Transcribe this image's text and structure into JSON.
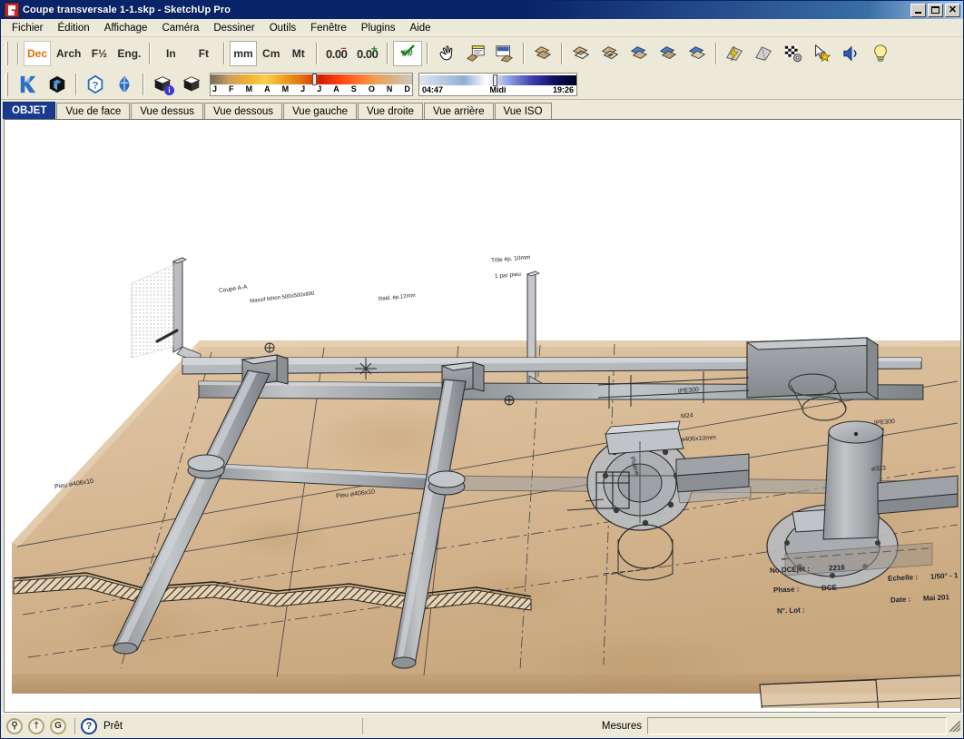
{
  "window": {
    "title": "Coupe transversale 1-1.skp - SketchUp Pro",
    "app_icon": "sketchup-icon",
    "minimize_label": "_",
    "maximize_label": "□",
    "close_label": "✕"
  },
  "menubar": {
    "items": [
      {
        "label": "Fichier",
        "accel": "F"
      },
      {
        "label": "Édition",
        "accel": "É"
      },
      {
        "label": "Affichage",
        "accel": "h"
      },
      {
        "label": "Caméra",
        "accel": "a"
      },
      {
        "label": "Dessiner",
        "accel": "D"
      },
      {
        "label": "Outils",
        "accel": "O"
      },
      {
        "label": "Fenêtre",
        "accel": "F"
      },
      {
        "label": "Plugins",
        "accel": ""
      },
      {
        "label": "Aide",
        "accel": "A"
      }
    ]
  },
  "toolbar_units": {
    "formats": [
      {
        "label": "Dec",
        "name": "unit-decimal",
        "active": true
      },
      {
        "label": "Arch",
        "name": "unit-architectural",
        "active": false
      },
      {
        "label": "F½",
        "name": "unit-fractional",
        "active": false
      },
      {
        "label": "Eng.",
        "name": "unit-engineering",
        "active": false
      }
    ],
    "imperial": [
      {
        "label": "In",
        "name": "unit-inches",
        "active": false
      },
      {
        "label": "Ft",
        "name": "unit-feet",
        "active": false
      }
    ],
    "metric": [
      {
        "label": "mm",
        "name": "unit-millimeters",
        "active": true
      },
      {
        "label": "Cm",
        "name": "unit-centimeters",
        "active": false
      },
      {
        "label": "Mt",
        "name": "unit-meters",
        "active": false
      }
    ],
    "precision": [
      {
        "label": "0.00",
        "name": "precision-decrease-button",
        "badge": "−",
        "badge_color": "#d02b20"
      },
      {
        "label": "0.00",
        "name": "precision-increase-button",
        "badge": "+",
        "badge_color": "#2c8c2c"
      }
    ],
    "snap": {
      "label": "##",
      "name": "snap-toggle-button"
    }
  },
  "toolbar_tools": {
    "items": [
      {
        "name": "pan-hand-icon",
        "title": "Panoramique"
      },
      {
        "name": "entity-info-icon",
        "title": "Infos sur l'entité"
      },
      {
        "name": "materials-icon",
        "title": "Matériaux"
      }
    ]
  },
  "toolbar_layers": {
    "items": [
      {
        "name": "group-icon",
        "title": "Groupe"
      },
      {
        "name": "layer-wireframe-icon",
        "title": "Filaire"
      },
      {
        "name": "layer-hidden-line-icon",
        "title": "Ligne cachée"
      },
      {
        "name": "layer-shaded-icon",
        "title": "Ombré"
      },
      {
        "name": "layer-texture-icon",
        "title": "Ombré avec textures"
      },
      {
        "name": "layer-monochrome-icon",
        "title": "Monochrome"
      }
    ]
  },
  "toolbar_render": {
    "items": [
      {
        "name": "render-lightning-icon",
        "title": "Rendu rapide"
      },
      {
        "name": "render-icon",
        "title": "Rendu"
      },
      {
        "name": "render-settings-icon",
        "title": "Options de rendu"
      },
      {
        "name": "select-star-icon",
        "title": "Sélection"
      },
      {
        "name": "sound-icon",
        "title": "Son"
      },
      {
        "name": "lightbulb-icon",
        "title": "Éclairage"
      }
    ]
  },
  "toolbar_row2": {
    "left_items": [
      {
        "name": "kerkythea-k-icon",
        "title": "Kerkythea"
      },
      {
        "name": "cube-3d-icon",
        "title": "Modèle 3D"
      },
      {
        "name": "help-hex-icon",
        "title": "Aide"
      },
      {
        "name": "plugin-ornament-icon",
        "title": "Extension"
      }
    ],
    "shadow_items": [
      {
        "name": "shadow-info-icon",
        "title": "Ombres - infos"
      },
      {
        "name": "shadow-icon",
        "title": "Ombres"
      }
    ]
  },
  "shadow_sliders": {
    "month": {
      "name": "month-slider",
      "labels": [
        "J",
        "F",
        "M",
        "A",
        "M",
        "J",
        "J",
        "A",
        "S",
        "O",
        "N",
        "D"
      ],
      "knob_position_pct": 51
    },
    "time": {
      "name": "time-slider",
      "start_label": "04:47",
      "noon_label": "Midi",
      "end_label": "19:26",
      "knob_position_pct": 47
    }
  },
  "view_tabs": {
    "items": [
      {
        "label": "OBJET",
        "name": "tab-objet",
        "selected": true
      },
      {
        "label": "Vue de face",
        "name": "tab-vue-de-face",
        "selected": false
      },
      {
        "label": "Vue dessus",
        "name": "tab-vue-dessus",
        "selected": false
      },
      {
        "label": "Vue dessous",
        "name": "tab-vue-dessous",
        "selected": false
      },
      {
        "label": "Vue gauche",
        "name": "tab-vue-gauche",
        "selected": false
      },
      {
        "label": "Vue droite",
        "name": "tab-vue-droite",
        "selected": false
      },
      {
        "label": "Vue arrière",
        "name": "tab-vue-arriere",
        "selected": false
      },
      {
        "label": "Vue ISO",
        "name": "tab-vue-iso",
        "selected": false
      }
    ]
  },
  "canvas": {
    "background": "#ffffff",
    "paper_color": "#d8bb97",
    "paper_shade": "#c7a17a",
    "metal_color": "#a9abae",
    "metal_dark": "#8b8e92",
    "model_description": "Vue 3D d'un plan papier avec pieux tubulaires, platines et poutrelles",
    "title_block": {
      "rows_left": [
        {
          "label": "No.DCEjet :",
          "value": "2216"
        },
        {
          "label": "Phase :",
          "value": "DCE"
        },
        {
          "label": "N°. Lot :",
          "value": ""
        }
      ],
      "rows_right": [
        {
          "label": "Echelle :",
          "value": "1/50° - 1"
        },
        {
          "label": "Date :",
          "value": "Mai 201"
        }
      ]
    },
    "annotations": [
      {
        "text": "Pieu ø406x10",
        "name": "annotation-pieu-left"
      },
      {
        "text": "Pieu ø406x10",
        "name": "annotation-pieu-center"
      },
      {
        "text": "M24",
        "name": "annotation-m24"
      },
      {
        "text": "ø406x10mm",
        "name": "annotation-diam406"
      },
      {
        "text": "IPE300",
        "name": "annotation-ipe300-left"
      },
      {
        "text": "IPE300",
        "name": "annotation-ipe300-right"
      },
      {
        "text": "ø323",
        "name": "annotation-diam323"
      },
      {
        "text": "Platine",
        "name": "annotation-platine"
      },
      {
        "text": "Coupe A-A",
        "name": "annotation-coupe"
      },
      {
        "text": "Tôle ép. 10mm",
        "name": "annotation-tole"
      },
      {
        "text": "1 par pieu",
        "name": "annotation-par-pieu"
      },
      {
        "text": "Massif béton 500x500x800",
        "name": "annotation-massif"
      },
      {
        "text": "Raid. ép.12mm",
        "name": "annotation-raid"
      }
    ]
  },
  "statusbar": {
    "icons": [
      {
        "name": "geo-location-icon",
        "glyph": "⚲"
      },
      {
        "name": "person-icon",
        "glyph": "†"
      },
      {
        "name": "credits-icon",
        "glyph": "G"
      }
    ],
    "help_icon": {
      "name": "help-circle-icon",
      "glyph": "?"
    },
    "status_text": "Prêt",
    "measurements_label": "Mesures",
    "measurements_value": "",
    "measurements_placeholder": ""
  }
}
